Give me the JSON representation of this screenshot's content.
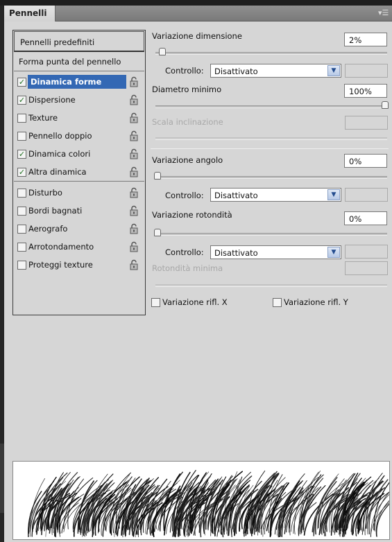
{
  "panel": {
    "tab_title": "Pennelli",
    "menu_icon": "panel-menu-icon"
  },
  "left": {
    "preset_button": "Pennelli predefiniti",
    "tip_shape": "Forma punta del pennello",
    "items": [
      {
        "label": "Dinamica forme",
        "checked": true,
        "selected": true
      },
      {
        "label": "Dispersione",
        "checked": true,
        "selected": false
      },
      {
        "label": "Texture",
        "checked": false,
        "selected": false
      },
      {
        "label": "Pennello doppio",
        "checked": false,
        "selected": false
      },
      {
        "label": "Dinamica colori",
        "checked": true,
        "selected": false
      },
      {
        "label": "Altra dinamica",
        "checked": true,
        "selected": false
      },
      {
        "label": "Disturbo",
        "checked": false,
        "selected": false
      },
      {
        "label": "Bordi bagnati",
        "checked": false,
        "selected": false
      },
      {
        "label": "Aerografo",
        "checked": false,
        "selected": false
      },
      {
        "label": "Arrotondamento",
        "checked": false,
        "selected": false
      },
      {
        "label": "Proteggi texture",
        "checked": false,
        "selected": false
      }
    ]
  },
  "right": {
    "size_jitter": {
      "label": "Variazione dimensione",
      "value": "2%",
      "slider_fraction": 0.02
    },
    "control1": {
      "label": "Controllo:",
      "value": "Disattivato"
    },
    "min_diameter": {
      "label": "Diametro minimo",
      "value": "100%",
      "slider_fraction": 1.0
    },
    "tilt_scale": {
      "label": "Scala inclinazione",
      "value": ""
    },
    "angle_jitter": {
      "label": "Variazione angolo",
      "value": "0%",
      "slider_fraction": 0
    },
    "control2": {
      "label": "Controllo:",
      "value": "Disattivato"
    },
    "roundness_jitter": {
      "label": "Variazione rotondità",
      "value": "0%",
      "slider_fraction": 0
    },
    "control3": {
      "label": "Controllo:",
      "value": "Disattivato"
    },
    "min_roundness": {
      "label": "Rotondità minima",
      "value": ""
    },
    "flip_x": {
      "label": "Variazione rifl. X",
      "checked": false
    },
    "flip_y": {
      "label": "Variazione rifl. Y",
      "checked": false
    }
  },
  "colors": {
    "selection": "#3368b4",
    "panel_bg": "#d6d6d6",
    "check": "#1f6f1f"
  }
}
